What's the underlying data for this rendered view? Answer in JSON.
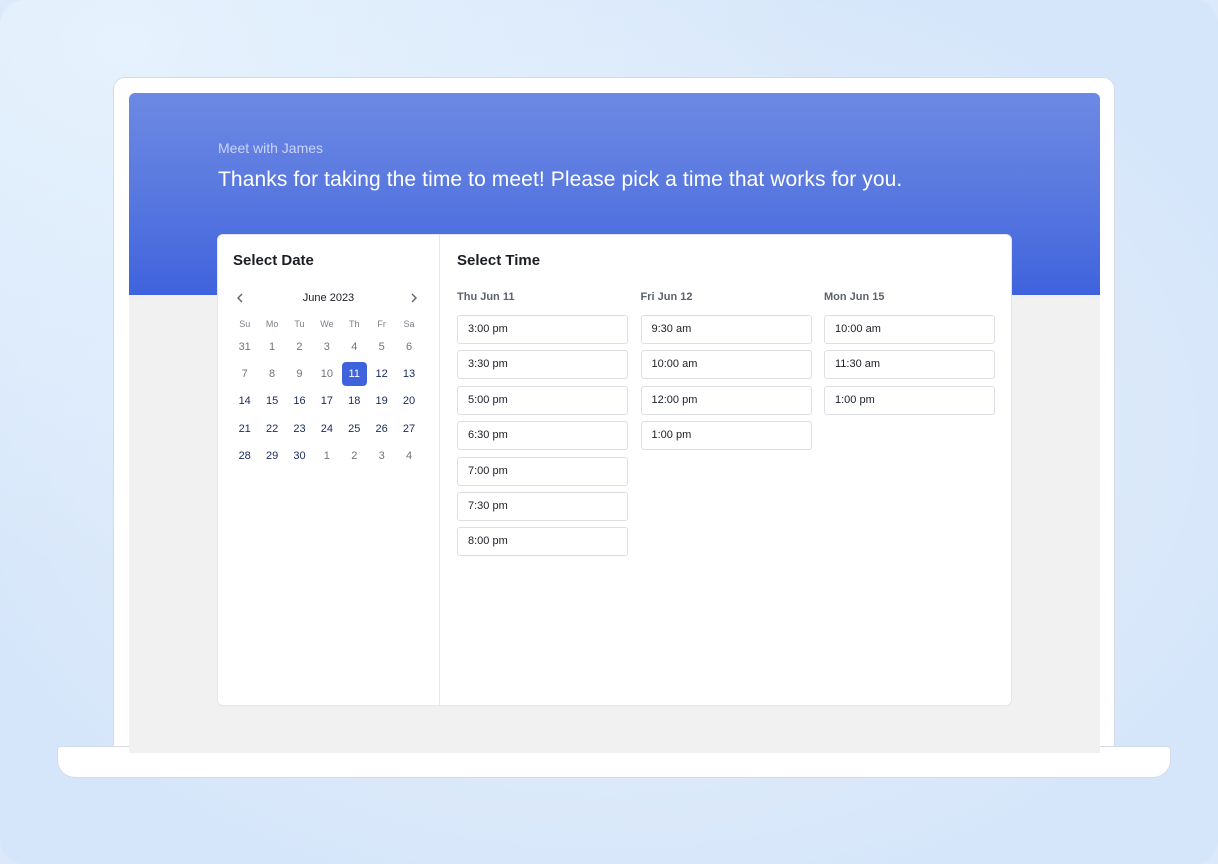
{
  "hero": {
    "subtitle": "Meet with James",
    "title": "Thanks for taking the time to meet! Please pick a time that works for you."
  },
  "date_pane": {
    "title": "Select Date",
    "month": "June 2023",
    "prev_icon": "chevron-left-icon",
    "next_icon": "chevron-right-icon",
    "weekdays": [
      "Su",
      "Mo",
      "Tu",
      "We",
      "Th",
      "Fr",
      "Sa"
    ],
    "weeks": [
      [
        {
          "d": "31",
          "s": "inactive"
        },
        {
          "d": "1",
          "s": "inactive"
        },
        {
          "d": "2",
          "s": "inactive"
        },
        {
          "d": "3",
          "s": "inactive"
        },
        {
          "d": "4",
          "s": "inactive"
        },
        {
          "d": "5",
          "s": "inactive"
        },
        {
          "d": "6",
          "s": "inactive"
        }
      ],
      [
        {
          "d": "7",
          "s": "inactive"
        },
        {
          "d": "8",
          "s": "inactive"
        },
        {
          "d": "9",
          "s": "inactive"
        },
        {
          "d": "10",
          "s": "inactive"
        },
        {
          "d": "11",
          "s": "selected"
        },
        {
          "d": "12",
          "s": "active"
        },
        {
          "d": "13",
          "s": "active"
        }
      ],
      [
        {
          "d": "14",
          "s": "active"
        },
        {
          "d": "15",
          "s": "active"
        },
        {
          "d": "16",
          "s": "active"
        },
        {
          "d": "17",
          "s": "active"
        },
        {
          "d": "18",
          "s": "active"
        },
        {
          "d": "19",
          "s": "active"
        },
        {
          "d": "20",
          "s": "active"
        }
      ],
      [
        {
          "d": "21",
          "s": "active"
        },
        {
          "d": "22",
          "s": "active"
        },
        {
          "d": "23",
          "s": "active"
        },
        {
          "d": "24",
          "s": "active"
        },
        {
          "d": "25",
          "s": "active"
        },
        {
          "d": "26",
          "s": "active"
        },
        {
          "d": "27",
          "s": "active"
        }
      ],
      [
        {
          "d": "28",
          "s": "active"
        },
        {
          "d": "29",
          "s": "active"
        },
        {
          "d": "30",
          "s": "active"
        },
        {
          "d": "1",
          "s": "inactive"
        },
        {
          "d": "2",
          "s": "inactive"
        },
        {
          "d": "3",
          "s": "inactive"
        },
        {
          "d": "4",
          "s": "inactive"
        }
      ]
    ]
  },
  "time_pane": {
    "title": "Select Time",
    "columns": [
      {
        "heading": "Thu Jun 11",
        "slots": [
          "3:00 pm",
          "3:30 pm",
          "5:00 pm",
          "6:30 pm",
          "7:00 pm",
          "7:30 pm",
          "8:00 pm"
        ]
      },
      {
        "heading": "Fri Jun 12",
        "slots": [
          "9:30 am",
          "10:00 am",
          "12:00 pm",
          "1:00 pm"
        ]
      },
      {
        "heading": "Mon Jun 15",
        "slots": [
          "10:00 am",
          "11:30 am",
          "1:00 pm"
        ]
      }
    ]
  },
  "colors": {
    "accent": "#3f63dd",
    "hero_top": "#6d89e4"
  }
}
